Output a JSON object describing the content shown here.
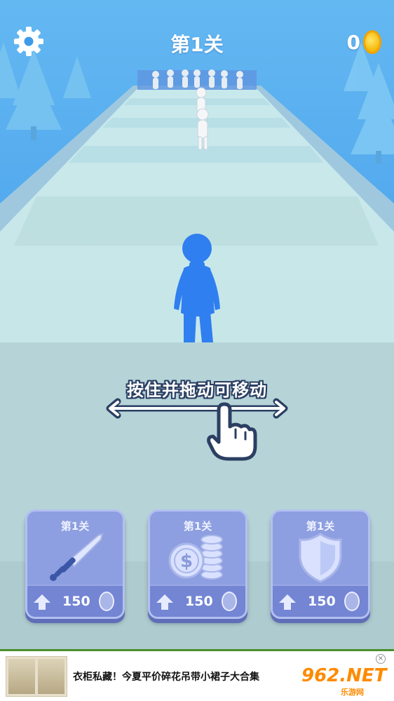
{
  "hud": {
    "settings_icon": "gear-icon",
    "level_title": "第1关",
    "coin_count": "0",
    "coin_icon": "coin-icon"
  },
  "hint": {
    "text": "按住并拖动可移动",
    "icons": [
      "double-arrow-icon",
      "pointing-hand-icon"
    ]
  },
  "upgrades": [
    {
      "level": "第1关",
      "icon": "sword-icon",
      "cost": "150"
    },
    {
      "level": "第1关",
      "icon": "coin-stack-icon",
      "cost": "150"
    },
    {
      "level": "第1关",
      "icon": "shield-icon",
      "cost": "150"
    }
  ],
  "ad": {
    "title": "衣柜私藏！今夏平价碎花吊带小裙子大合集",
    "brand": "962.NET",
    "brand_sub": "乐游网"
  },
  "colors": {
    "player": "#2f7ff0",
    "enemy": "#f2f2f2",
    "sky": "#3f9ae8",
    "track": "#d7eeee",
    "card": "#8d9fe0"
  }
}
